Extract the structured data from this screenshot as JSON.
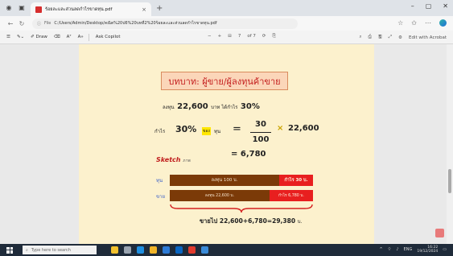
{
  "browser": {
    "tab_title": "ร้อยละและส่วนลดกำไรขาดทุน.pdf",
    "tab_close": "×",
    "new_tab": "+",
    "window_controls": [
      "–",
      "▢",
      "✕"
    ],
    "url_prefix": "File",
    "url": "C:/Users/Admin/Desktop/คณิต%20ป6%20บทที่2%20ร้อยละและส่วนลดกำไรขาดทุน.pdf"
  },
  "pdf_toolbar": {
    "draw_label": "Draw",
    "ask_copilot": "Ask Copilot",
    "zoom_minus": "−",
    "zoom_plus": "+",
    "page_current": "7",
    "page_total": "of 7",
    "edit_with_acrobat": "Edit with Acrobat"
  },
  "page": {
    "heading": "บทบาท: ผู้ขาย/ผู้ลงทุนค้าขาย",
    "line1_a": "ลงทุน",
    "line1_amount": "22,600",
    "line1_b": "บาท ได้กำไร",
    "line1_percent": "30%",
    "formula_lead": "กำไร",
    "formula_percent": "30%",
    "formula_highlight": "ของ",
    "formula_tun": "ทุน",
    "formula_eq": "=",
    "formula_num": "30",
    "formula_den": "100",
    "formula_times": "×",
    "formula_amount": "22,600",
    "result": "= 6,780",
    "sketch": "Sketch",
    "sketch_small": "ภาพ",
    "row1_label": "ทุน",
    "row2_label": "ขาย",
    "bar1_text": "ลงทุน 100 บ.",
    "bar1_red_text": "กำไร 30 บ.",
    "bar2_text": "ลงทุน 22,600 บ.",
    "bar2_red_text": "กำไร 6,780 บ.",
    "total": "ขายไป 22,600+6,780=29,380",
    "total_unit": "บ."
  },
  "taskbar": {
    "search_placeholder": "Type here to search",
    "time": "16:22",
    "date": "19/12/2024",
    "lang": "ENG"
  },
  "colors": {
    "page_bg": "#fcf1cd",
    "heading_text": "#c41e1e",
    "bar_brown": "#7b3a08",
    "bar_red": "#e81f1f",
    "highlight": "#ffe600",
    "brace_red": "#d42020"
  }
}
